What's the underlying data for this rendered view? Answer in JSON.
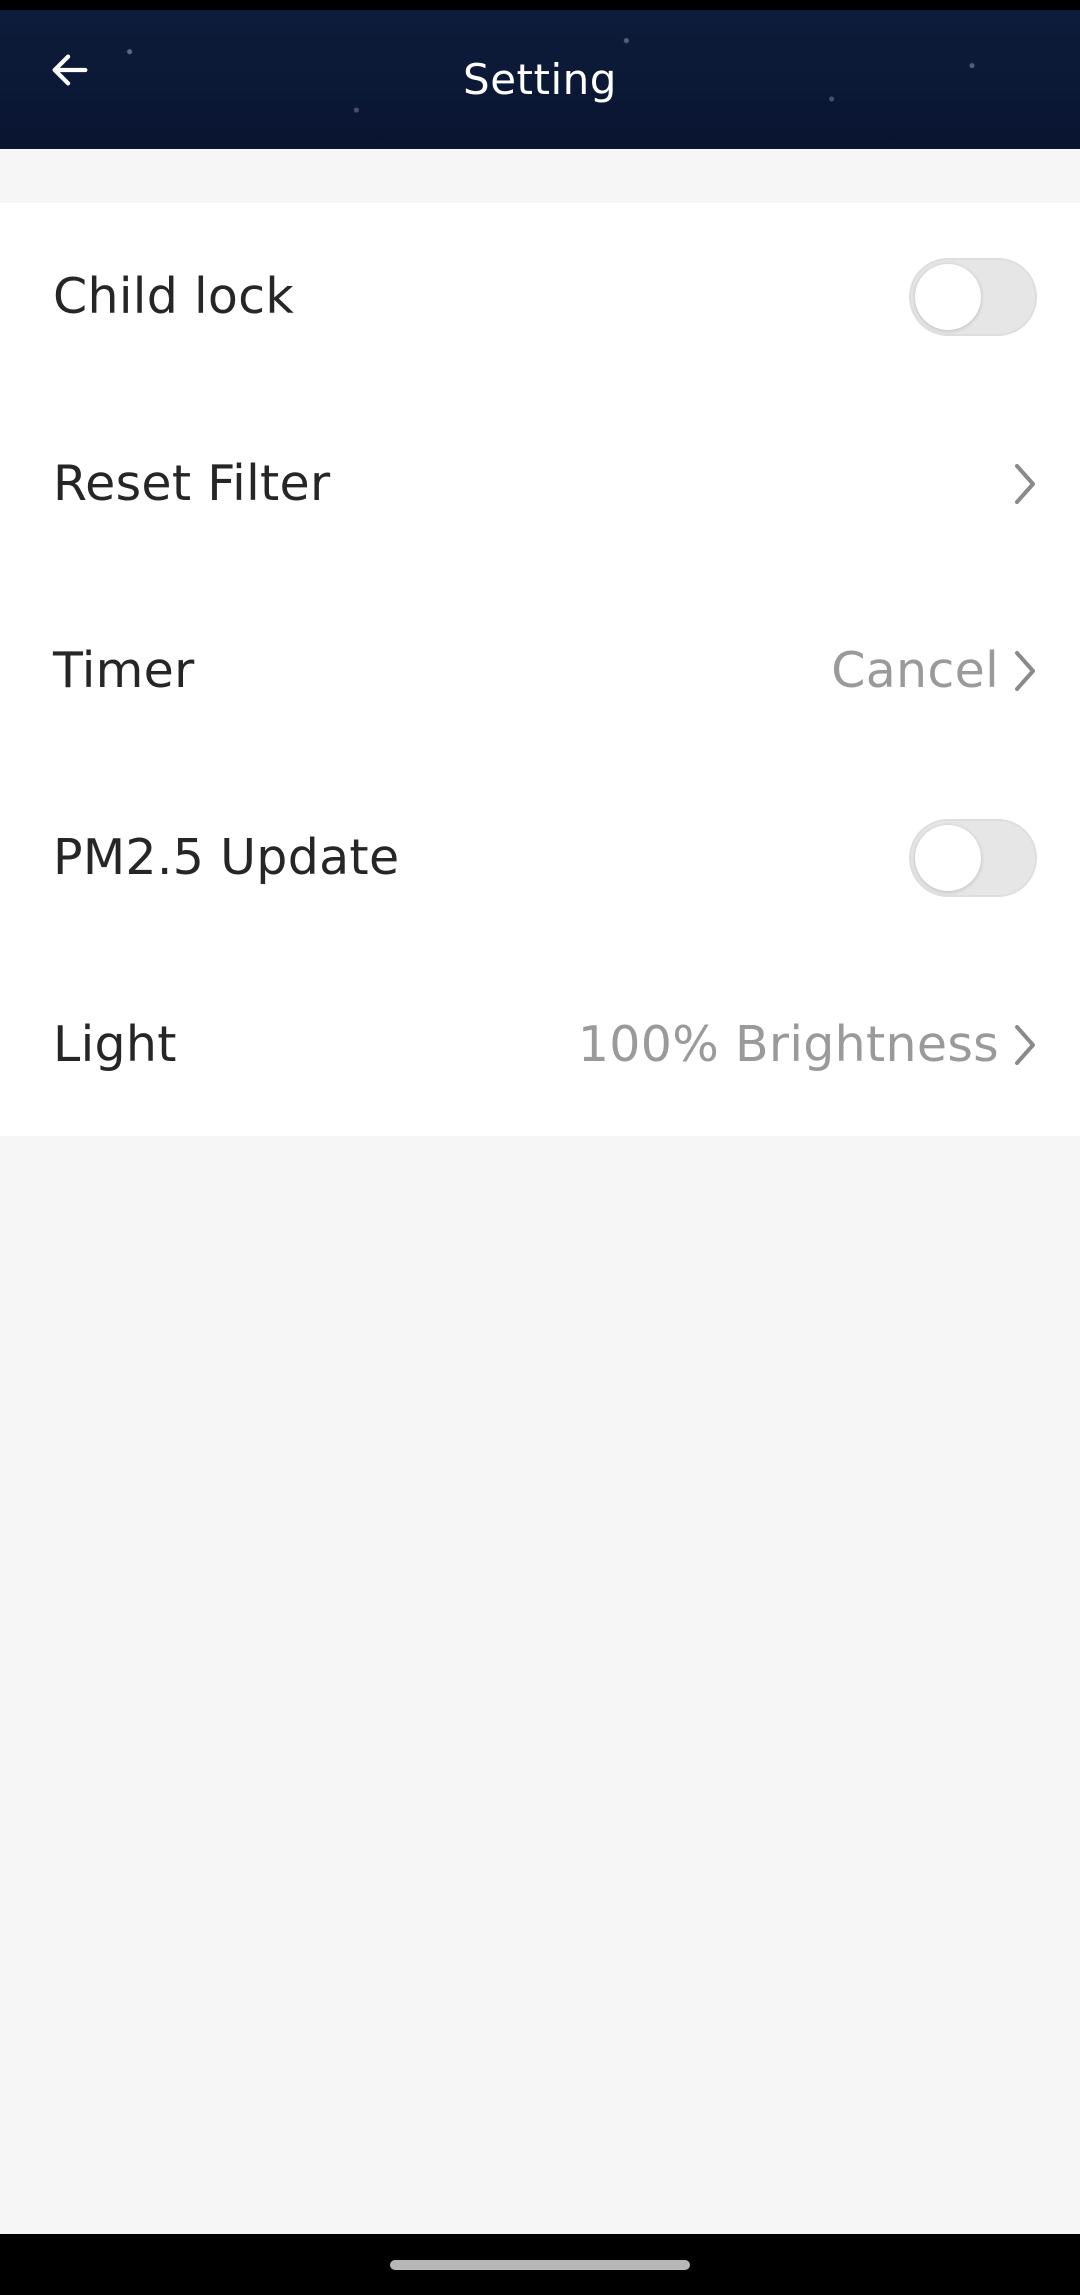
{
  "header": {
    "title": "Setting",
    "back_icon": "arrow-left-icon"
  },
  "settings": {
    "items": [
      {
        "label": "Child lock",
        "control": "toggle",
        "on": false
      },
      {
        "label": "Reset Filter",
        "control": "chevron",
        "value": ""
      },
      {
        "label": "Timer",
        "control": "chevron",
        "value": "Cancel"
      },
      {
        "label": "PM2.5 Update",
        "control": "toggle",
        "on": false
      },
      {
        "label": "Light",
        "control": "chevron",
        "value": "100% Brightness"
      }
    ]
  },
  "colors": {
    "header_bg": "#0b1836",
    "page_bg": "#f6f6f6",
    "row_bg": "#ffffff",
    "label_text": "#262626",
    "value_text": "#9a9a9a",
    "toggle_off": "#e6e6e6"
  }
}
